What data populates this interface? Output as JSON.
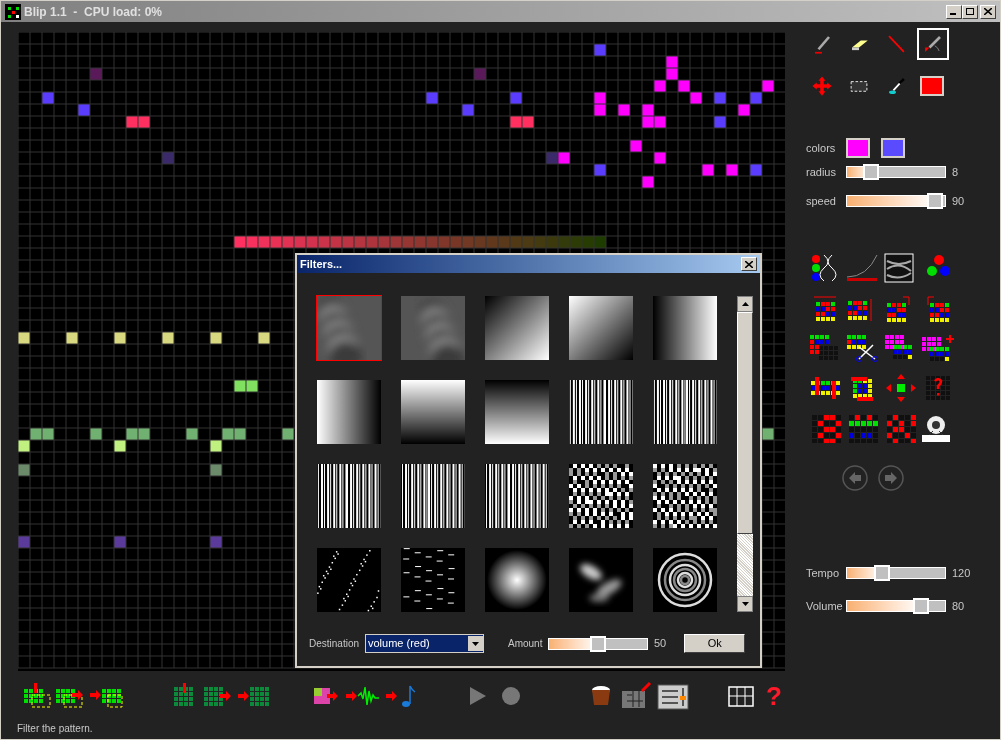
{
  "window": {
    "title": "Blip 1.1  -  CPU load: 0%"
  },
  "tools": [
    {
      "kind": "pencil",
      "selected": false
    },
    {
      "kind": "eraser",
      "selected": false
    },
    {
      "kind": "line",
      "selected": false
    },
    {
      "kind": "spray",
      "selected": true
    },
    {
      "kind": "move",
      "selected": false
    },
    {
      "kind": "select",
      "selected": false
    },
    {
      "kind": "eyedropper",
      "selected": false
    }
  ],
  "current_color": {
    "color": "#ff0000"
  },
  "colors": {
    "label": "colors",
    "swatches": [
      {
        "color": "#ff00ff"
      },
      {
        "color": "#5a4bff"
      }
    ]
  },
  "brush_sliders": [
    {
      "label": "radius",
      "level": 0.24,
      "reading": "8"
    },
    {
      "label": "speed",
      "level": 0.9,
      "reading": "90"
    }
  ],
  "playback_sliders": [
    {
      "label": "Tempo",
      "level": 0.36,
      "reading": "120"
    },
    {
      "label": "Volume",
      "level": 0.76,
      "reading": "80"
    }
  ],
  "filters_dialog": {
    "title": "Filters...",
    "thumbnails": [
      {
        "kind": "clouds",
        "selected": true
      },
      {
        "kind": "clouds",
        "selected": false
      },
      {
        "kind": "gradient-diag",
        "selected": false
      },
      {
        "kind": "gradient-diag-reverse",
        "selected": false
      },
      {
        "kind": "gradient-right",
        "selected": false
      },
      {
        "kind": "gradient-left",
        "selected": false
      },
      {
        "kind": "gradient-up",
        "selected": false
      },
      {
        "kind": "gradient-down",
        "selected": false
      },
      {
        "kind": "stripes",
        "selected": false
      },
      {
        "kind": "stripes",
        "selected": false
      },
      {
        "kind": "stripes",
        "selected": false
      },
      {
        "kind": "stripes",
        "selected": false
      },
      {
        "kind": "stripes",
        "selected": false
      },
      {
        "kind": "noise",
        "selected": false
      },
      {
        "kind": "noise",
        "selected": false
      },
      {
        "kind": "sparkles",
        "selected": false
      },
      {
        "kind": "dashes",
        "selected": false
      },
      {
        "kind": "radial",
        "selected": false
      },
      {
        "kind": "blobs",
        "selected": false
      },
      {
        "kind": "rings",
        "selected": false
      }
    ],
    "destination": {
      "label": "Destination",
      "value": "volume (red)"
    },
    "amount": {
      "label": "Amount",
      "level": 0.5,
      "reading": "50"
    },
    "ok_button": "Ok"
  },
  "help_button": "?",
  "status_bar": "Filter the pattern."
}
